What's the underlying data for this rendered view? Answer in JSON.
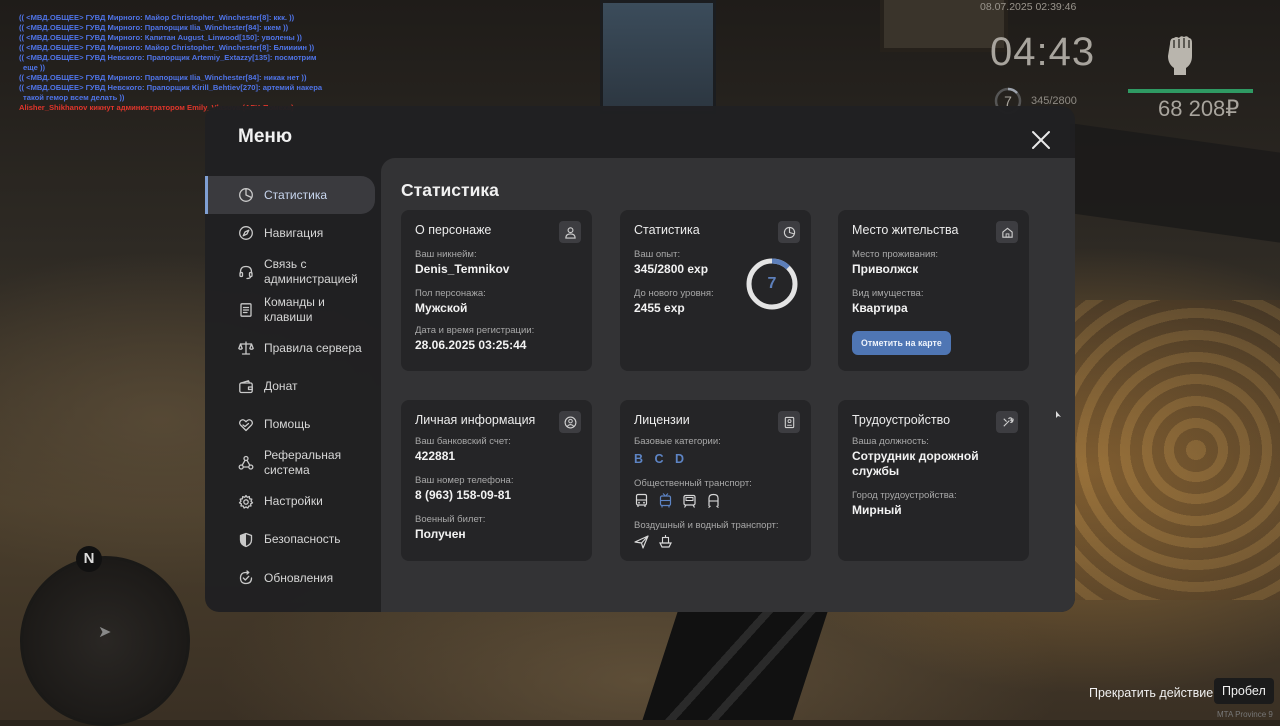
{
  "hud": {
    "chat": [
      {
        "text": "(( <МВД.ОБЩЕЕ> ГУВД Мирного: Майор Christopher_Winchester[8]: ккк. ))",
        "color": "blue"
      },
      {
        "text": "(( <МВД.ОБЩЕЕ> ГУВД Мирного: Прапорщик Ilia_Winchester[84]: ккем ))",
        "color": "blue"
      },
      {
        "text": "(( <МВД.ОБЩЕЕ> ГУВД Мирного: Капитан August_Linwood[150]: уволены ))",
        "color": "blue"
      },
      {
        "text": "(( <МВД.ОБЩЕЕ> ГУВД Мирного: Майор Christopher_Winchester[8]: Блиииин ))",
        "color": "blue"
      },
      {
        "text": "(( <МВД.ОБЩЕЕ> ГУВД Невского: Прапорщик Artemiy_Extazzy[135]: посмотрим",
        "color": "blue"
      },
      {
        "text": "еще ))",
        "color": "blue"
      },
      {
        "text": "(( <МВД.ОБЩЕЕ> ГУВД Мирного: Прапорщик Ilia_Winchester[84]: никак нет ))",
        "color": "blue"
      },
      {
        "text": "(( <МВД.ОБЩЕЕ> ГУВД Невского: Прапорщик Kirill_Behtiev[270]: артемий накера",
        "color": "blue"
      },
      {
        "text": "такой гемор всем делать ))",
        "color": "blue"
      },
      {
        "text": "Alisher_Shikhanov кикнут администратором Emily_Vlasova (AFK-Помеха)",
        "color": "red"
      }
    ],
    "date": "08.07.2025 02:39:46",
    "time": "04:43",
    "level": "7",
    "exp": "345/2800",
    "money": "68 208₽",
    "health_fraction": 1.0,
    "compass": "N",
    "action_label": "Прекратить действие",
    "action_key": "Пробел",
    "watermark": "MTA Province 9"
  },
  "menu": {
    "title": "Меню",
    "nav": [
      {
        "label": "Статистика",
        "icon": "pie-chart-icon",
        "active": true
      },
      {
        "label": "Навигация",
        "icon": "compass-icon",
        "active": false
      },
      {
        "label": "Связь с\nадминистрацией",
        "icon": "headset-icon",
        "active": false
      },
      {
        "label": "Команды и\nклавиши",
        "icon": "document-icon",
        "active": false
      },
      {
        "label": "Правила сервера",
        "icon": "scales-icon",
        "active": false
      },
      {
        "label": "Донат",
        "icon": "wallet-icon",
        "active": false
      },
      {
        "label": "Помощь",
        "icon": "heart-hand-icon",
        "active": false
      },
      {
        "label": "Реферальная\nсистема",
        "icon": "network-icon",
        "active": false
      },
      {
        "label": "Настройки",
        "icon": "gear-icon",
        "active": false
      },
      {
        "label": "Безопасность",
        "icon": "shield-icon",
        "active": false
      },
      {
        "label": "Обновления",
        "icon": "refresh-check-icon",
        "active": false
      }
    ],
    "content_title": "Статистика",
    "cards": {
      "person": {
        "title": "О персонаже",
        "icon": "user-icon",
        "nick_label": "Ваш никнейм:",
        "nick": "Denis_Temnikov",
        "gender_label": "Пол персонажа:",
        "gender": "Мужской",
        "reg_label": "Дата и время регистрации:",
        "reg": "28.06.2025 03:25:44"
      },
      "stats": {
        "title": "Статистика",
        "icon": "pie-chart-icon",
        "exp_label": "Ваш опыт:",
        "exp": "345/2800 exp",
        "next_label": "До нового уровня:",
        "next": "2455 exp",
        "level": "7",
        "progress_fraction": 0.1232
      },
      "home": {
        "title": "Место жительства",
        "icon": "house-icon",
        "place_label": "Место проживания:",
        "place": "Приволжск",
        "type_label": "Вид имущества:",
        "type": "Квартира",
        "button": "Отметить на карте"
      },
      "personal": {
        "title": "Личная информация",
        "icon": "user-circle-icon",
        "bank_label": "Ваш банковский счет:",
        "bank": "422881",
        "phone_label": "Ваш номер телефона:",
        "phone": "8 (963) 158-09-81",
        "military_label": "Военный билет:",
        "military": "Получен"
      },
      "licenses": {
        "title": "Лицензии",
        "icon": "id-card-icon",
        "base_label": "Базовые категории:",
        "base": [
          "B",
          "C",
          "D"
        ],
        "public_label": "Общественный транспорт:",
        "public_icons": [
          "bus-icon",
          "trolleybus-icon",
          "tram-icon",
          "metro-icon"
        ],
        "air_label": "Воздушный и водный транспорт:",
        "air_icons": [
          "plane-icon",
          "boat-icon"
        ]
      },
      "job": {
        "title": "Трудоустройство",
        "icon": "tools-icon",
        "position_label": "Ваша должность:",
        "position": "Сотрудник дорожной\nслужбы",
        "city_label": "Город трудоустройства:",
        "city": "Мирный"
      }
    }
  }
}
